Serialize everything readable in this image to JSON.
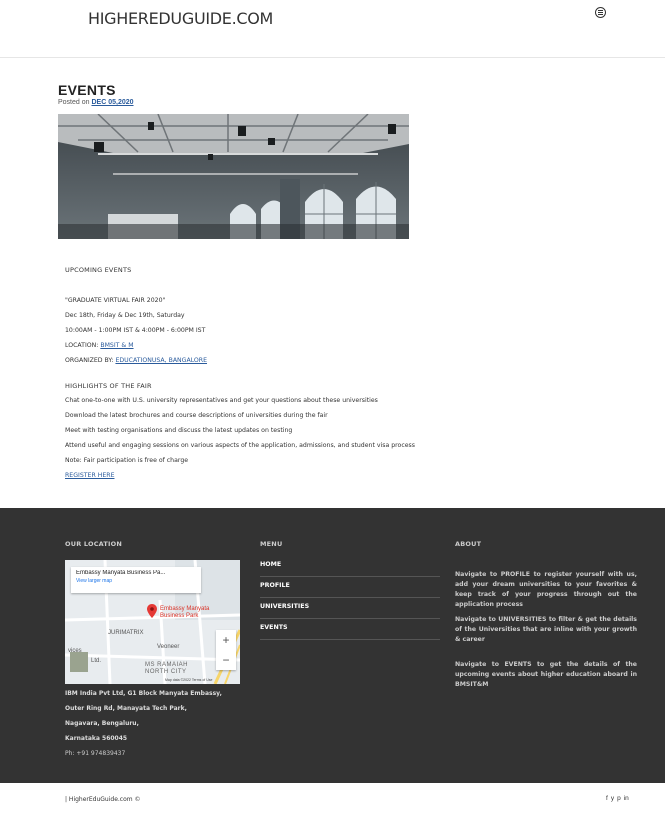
{
  "header": {
    "brand": "HIGHEREDUGUIDE.COM"
  },
  "article": {
    "title": "EVENTS",
    "posted_label": "Posted on",
    "posted_date": "DEC 05,2020",
    "upcoming_heading": "UPCOMING EVENTS",
    "event_name": "\"GRADUATE VIRTUAL FAIR 2020\"",
    "event_dates": "Dec 18th, Friday & Dec 19th, Saturday",
    "event_times": "10:00AM - 1:00PM IST & 4:00PM - 6:00PM IST",
    "location_label": "LOCATION:",
    "location_value": "BMSIT & M",
    "organizer_label": "ORGANIZED BY:",
    "organizer_value": "EDUCATIONUSA, BANGALORE",
    "highlights_heading": "HIGHLIGHTS OF THE FAIR",
    "highlights": [
      "Chat one-to-one with U.S. university representatives and get your questions about these universities",
      "Download the latest brochures and course descriptions of universities during the fair",
      "Meet with testing organisations and discuss the latest updates on testing",
      "Attend useful and engaging sessions on various aspects of the application, admissions, and student visa process",
      "Note: Fair participation is free of charge"
    ],
    "register_link": "REGISTER HERE"
  },
  "footer": {
    "location_title": "OUR LOCATION",
    "map": {
      "place_name": "Embassy Manyata Business Pa...",
      "view_larger": "View larger map",
      "pin_label_1": "Embassy Manyata",
      "pin_label_2": "Business Park",
      "label_jurimatrix": "JURIMATRIX",
      "label_veoneer": "Veoneer",
      "label_ltd": "Ltd.",
      "label_vices": "vices",
      "label_ms_ramaiah": "MS RAMAIAH",
      "label_north_city": "NORTH CITY",
      "zoom_in": "+",
      "zoom_out": "−",
      "map_data": "Map data ©2022",
      "terms": "Terms of Use"
    },
    "address_lines": [
      "IBM India Pvt Ltd, G1 Block Manyata Embassy,",
      "Outer Ring Rd, Manayata Tech Park,",
      "Nagavara, Bengaluru,",
      "Karnataka 560045",
      "Ph: +91 974839437"
    ],
    "menu_title": "MENU",
    "menu_items": [
      "HOME",
      "PROFILE",
      "UNIVERSITIES",
      "EVENTS"
    ],
    "about_title": "ABOUT",
    "about_paragraphs": [
      "Navigate to PROFILE to register yourself with us, add your dream universities to your favorites & keep track of your progress through out the application process",
      "Navigate to UNIVERSITIES to filter & get the details of the Universities that are inline with your growth & career",
      "Navigate to EVENTS to get the details of the upcoming events about higher education aboard in BMSIT&M"
    ]
  },
  "bottom": {
    "copyright": "| HigherEduGuide.com ©",
    "social_icons": [
      "facebook-icon",
      "twitter-icon",
      "pinterest-icon",
      "linkedin-icon"
    ],
    "social_glyphs": [
      "f",
      "y",
      "p",
      "in"
    ]
  }
}
